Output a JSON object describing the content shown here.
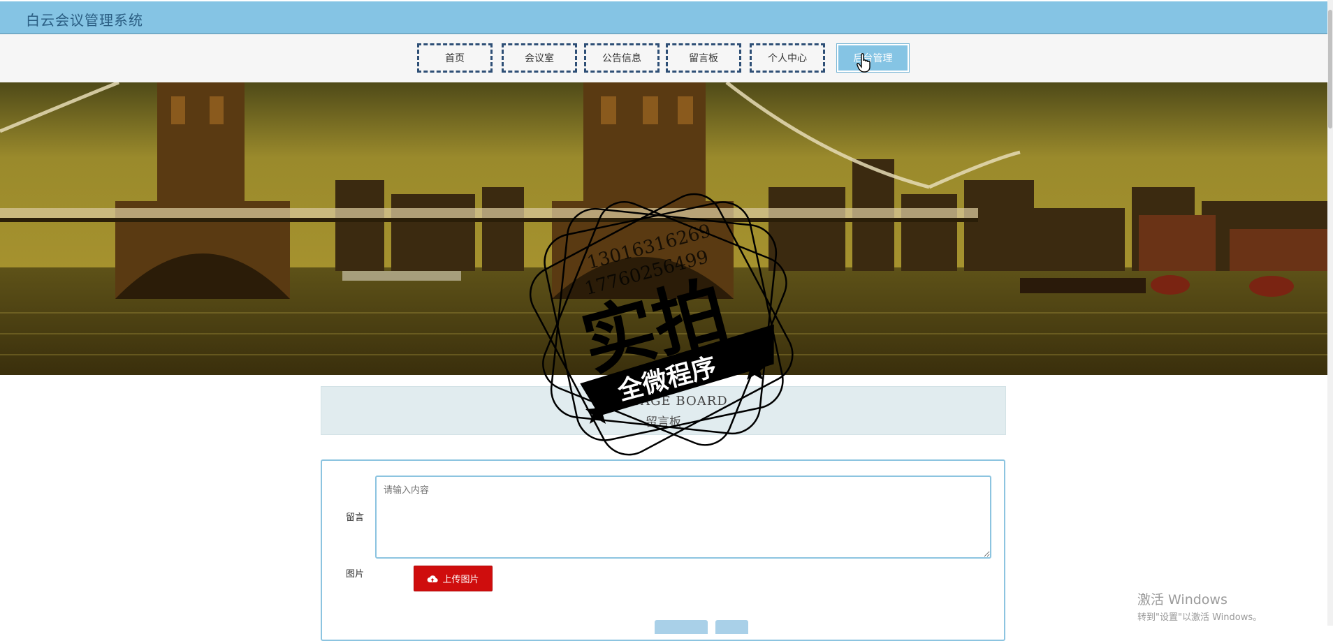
{
  "header": {
    "title": "白云会议管理系统"
  },
  "nav": {
    "items": [
      {
        "label": "首页"
      },
      {
        "label": "会议室"
      },
      {
        "label": "公告信息"
      },
      {
        "label": "留言板"
      },
      {
        "label": "个人中心"
      },
      {
        "label": "后台管理"
      }
    ],
    "active_index": 5
  },
  "section": {
    "title_en": "MESSAGE BOARD",
    "title_cn": "留言板"
  },
  "form": {
    "message_label": "留言",
    "message_placeholder": "请输入内容",
    "image_label": "图片",
    "upload_label": "上传图片",
    "upload_icon": "cloud-upload-icon"
  },
  "watermark": {
    "phone1": "13016316269",
    "phone2": "17760256499",
    "big_text": "实拍",
    "ribbon_text": "全微程序"
  },
  "os_notice": {
    "line1": "激活 Windows",
    "line2": "转到\"设置\"以激活 Windows。"
  },
  "colors": {
    "header_bg": "#85c4e4",
    "nav_border": "#2e4f76",
    "upload_btn": "#cf0d0d",
    "form_border": "#8cc4e0"
  }
}
